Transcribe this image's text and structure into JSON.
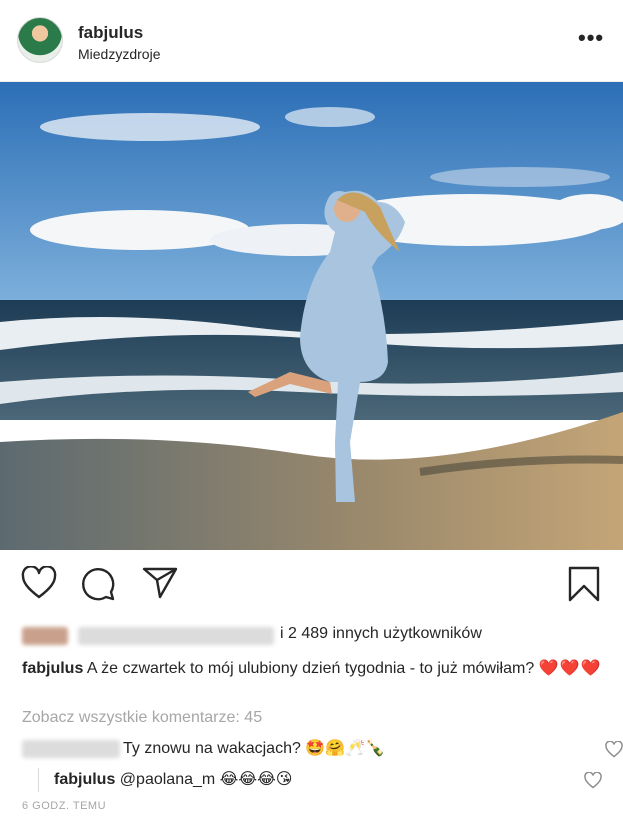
{
  "header": {
    "username": "fabjulus",
    "location": "Miedzyzdroje",
    "more_icon": "more-horizontal-icon",
    "more_glyph": "•••"
  },
  "photo": {
    "description_icon": "beach-photo",
    "colors": {
      "sky": "#3d7fc0",
      "sea": "#2b4a60",
      "sand": "#b89a6c"
    }
  },
  "actions": {
    "like_icon": "heart-outline-icon",
    "comment_icon": "comment-bubble-icon",
    "share_icon": "send-arrow-icon",
    "save_icon": "bookmark-icon"
  },
  "likes": {
    "text": "i 2 489 innych użytkowników"
  },
  "caption": {
    "username": "fabjulus",
    "text": "A że czwartek to mój ulubiony dzień tygodnia - to już mówiłam?",
    "emoji": "❤️❤️❤️"
  },
  "comments": {
    "view_all": "Zobacz wszystkie komentarze: 45",
    "first": {
      "text": "Ty znowu na wakacjach?",
      "emoji": "🤩🤗🥂🍾"
    },
    "reply": {
      "username": "fabjulus",
      "text": "@paolana_m",
      "emoji": "😂😂😂😘"
    }
  },
  "timestamp": "6 GODZ. TEMU"
}
